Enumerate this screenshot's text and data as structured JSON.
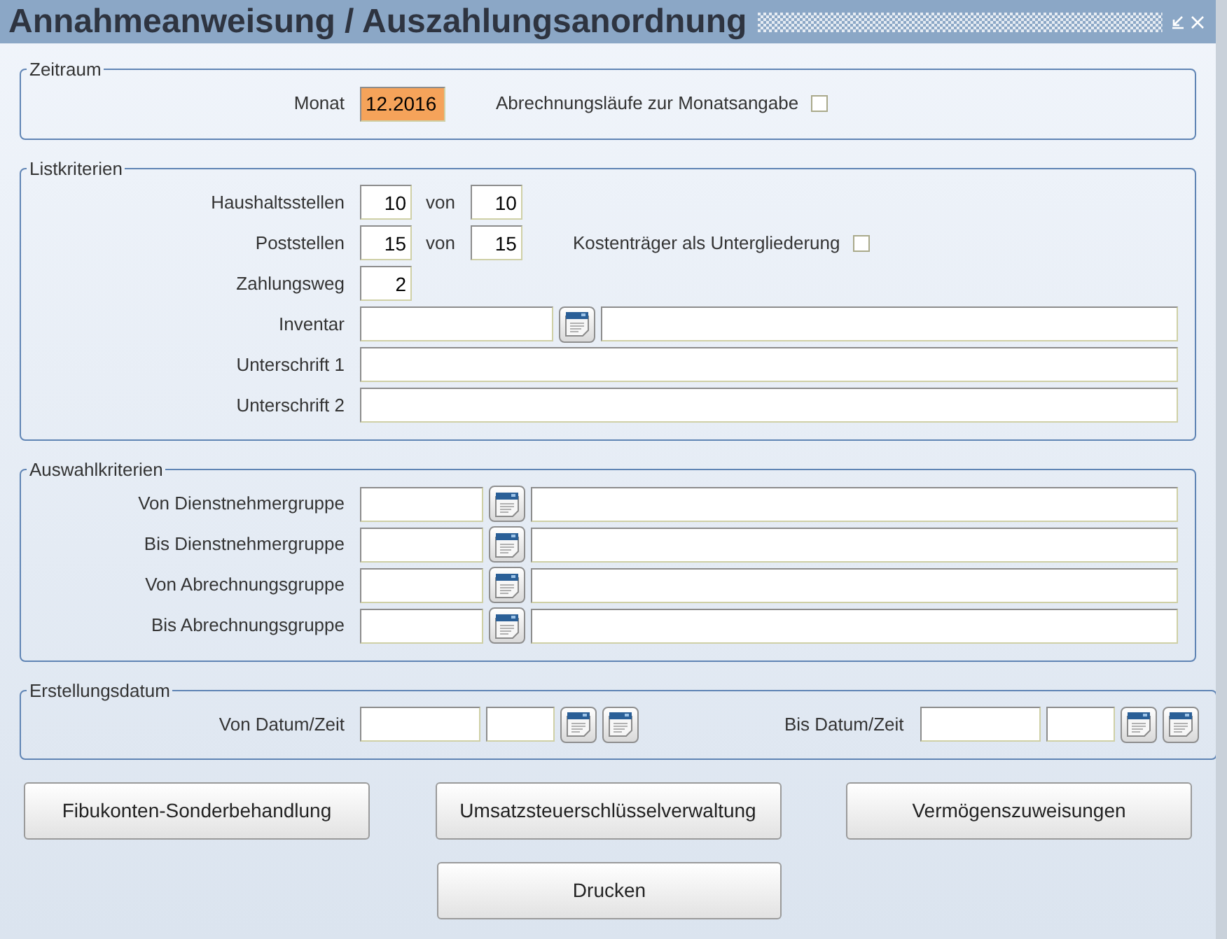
{
  "window": {
    "title": "Annahmeanweisung / Auszahlungsanordnung"
  },
  "sections": [
    {
      "legend": "Zeitraum",
      "rows": [
        {
          "label": "Monat",
          "items": [
            {
              "kind": "month",
              "value": "12.2016",
              "focused": true
            },
            {
              "kind": "option-label",
              "text": "Abrechnungsläufe zur Monatsangabe"
            },
            {
              "kind": "checkbox",
              "checked": false
            }
          ]
        }
      ]
    },
    {
      "legend": "Listkriterien",
      "rows": [
        {
          "label": "Haushaltsstellen",
          "items": [
            {
              "kind": "number",
              "value": "10",
              "focused": false
            },
            {
              "kind": "connector",
              "text": "von"
            },
            {
              "kind": "number",
              "value": "10",
              "focused": false
            }
          ]
        },
        {
          "label": "Poststellen",
          "items": [
            {
              "kind": "number",
              "value": "15",
              "focused": false
            },
            {
              "kind": "connector",
              "text": "von"
            },
            {
              "kind": "number",
              "value": "15",
              "focused": false
            },
            {
              "kind": "option-label",
              "text": "Kostenträger als Untergliederung"
            },
            {
              "kind": "checkbox",
              "checked": false
            }
          ]
        },
        {
          "label": "Zahlungsweg",
          "items": [
            {
              "kind": "number",
              "value": "2",
              "focused": false
            }
          ]
        },
        {
          "label": "Inventar",
          "items": [
            {
              "kind": "code",
              "focused": false
            },
            {
              "kind": "lookup"
            },
            {
              "kind": "text",
              "focused": false
            }
          ]
        },
        {
          "label": "Unterschrift 1",
          "items": [
            {
              "kind": "text",
              "focused": false
            }
          ]
        },
        {
          "label": "Unterschrift 2",
          "items": [
            {
              "kind": "text",
              "focused": false
            }
          ]
        }
      ]
    },
    {
      "legend": "Auswahlkriterien",
      "rows": [
        {
          "label": "Von Dienstnehmergruppe",
          "items": [
            {
              "kind": "group-code",
              "focused": false
            },
            {
              "kind": "lookup"
            },
            {
              "kind": "text",
              "focused": false
            }
          ]
        },
        {
          "label": "Bis Dienstnehmergruppe",
          "items": [
            {
              "kind": "group-code",
              "focused": false
            },
            {
              "kind": "lookup"
            },
            {
              "kind": "text",
              "focused": false
            }
          ]
        },
        {
          "label": "Von Abrechnungsgruppe",
          "items": [
            {
              "kind": "group-code",
              "focused": false
            },
            {
              "kind": "lookup"
            },
            {
              "kind": "text",
              "focused": false
            }
          ]
        },
        {
          "label": "Bis Abrechnungsgruppe",
          "items": [
            {
              "kind": "group-code",
              "focused": false
            },
            {
              "kind": "lookup"
            },
            {
              "kind": "text",
              "focused": false
            }
          ]
        }
      ]
    },
    {
      "legend": "Erstellungsdatum",
      "rows": [
        {
          "label": "Von Datum/Zeit",
          "items": [
            {
              "kind": "date",
              "focused": false
            },
            {
              "kind": "time",
              "focused": false
            },
            {
              "kind": "lookup"
            },
            {
              "kind": "lookup"
            },
            {
              "kind": "range-label",
              "text": "Bis Datum/Zeit"
            },
            {
              "kind": "date",
              "focused": false
            },
            {
              "kind": "time",
              "focused": false
            },
            {
              "kind": "lookup"
            },
            {
              "kind": "lookup"
            }
          ]
        }
      ]
    }
  ],
  "buttons": [
    "Fibukonten-Sonderbehandlung",
    "Umsatzsteuerschlüsselverwaltung",
    "Vermögenszuweisungen"
  ],
  "print_button": "Drucken"
}
